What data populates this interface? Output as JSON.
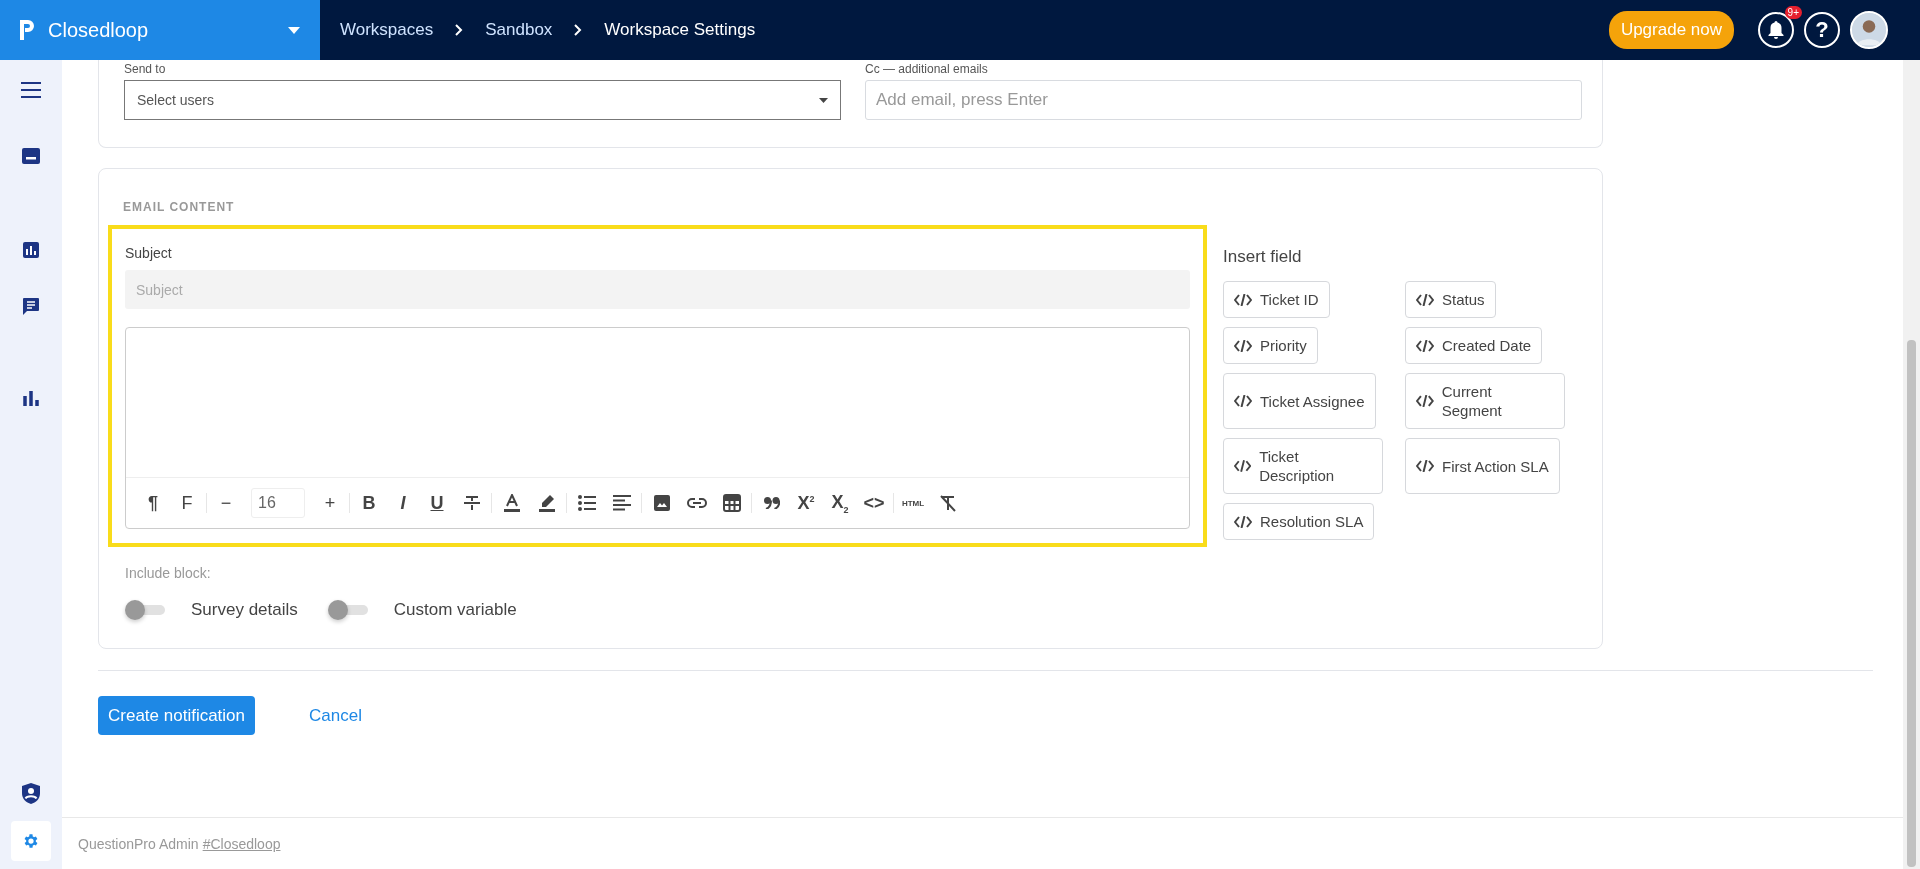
{
  "app": {
    "name": "Closedloop"
  },
  "breadcrumbs": [
    {
      "label": "Workspaces"
    },
    {
      "label": "Sandbox"
    },
    {
      "label": "Workspace Settings"
    }
  ],
  "header_actions": {
    "upgrade": "Upgrade now",
    "notification_badge": "9+",
    "help": "?"
  },
  "sidebar": {
    "items": [
      {
        "selected": false
      },
      {
        "selected": false
      },
      {
        "selected": false
      },
      {
        "selected": false
      },
      {
        "selected": false
      },
      {
        "selected": false
      },
      {
        "selected": true
      }
    ]
  },
  "recipients": {
    "send_to": {
      "label": "Send to",
      "placeholder": "Select users"
    },
    "cc": {
      "label": "Cc — additional emails",
      "placeholder": "Add email, press Enter"
    }
  },
  "email_content": {
    "heading": "EMAIL CONTENT",
    "subject": {
      "label": "Subject",
      "placeholder": "Subject"
    },
    "toolbar": [
      {
        "kind": "glyph",
        "text": "¶"
      },
      {
        "kind": "glyph",
        "text": "F"
      },
      {
        "kind": "divider"
      },
      {
        "kind": "glyph",
        "text": "−"
      },
      {
        "kind": "size",
        "text": "16"
      },
      {
        "kind": "glyph",
        "text": "+"
      },
      {
        "kind": "divider"
      },
      {
        "kind": "glyph",
        "text": "B"
      },
      {
        "kind": "glyph",
        "text": "I"
      },
      {
        "kind": "glyph",
        "text": "U"
      },
      {
        "kind": "icon"
      },
      {
        "kind": "divider"
      },
      {
        "kind": "icon"
      },
      {
        "kind": "icon"
      },
      {
        "kind": "divider"
      },
      {
        "kind": "icon"
      },
      {
        "kind": "icon"
      },
      {
        "kind": "divider"
      },
      {
        "kind": "icon"
      },
      {
        "kind": "icon"
      },
      {
        "kind": "icon"
      },
      {
        "kind": "divider"
      },
      {
        "kind": "icon"
      },
      {
        "kind": "glyph",
        "text": "X$^{2}$"
      },
      {
        "kind": "glyph",
        "text": "X$_{2}$"
      },
      {
        "kind": "glyph",
        "text": "<>"
      },
      {
        "kind": "divider"
      },
      {
        "kind": "glyph",
        "text": "HTML"
      },
      {
        "kind": "icon"
      }
    ],
    "insert_field": {
      "title": "Insert field",
      "fields": [
        {
          "label": "Ticket ID"
        },
        {
          "label": "Status"
        },
        {
          "label": "Priority"
        },
        {
          "label": "Created Date"
        },
        {
          "label": "Ticket Assignee"
        },
        {
          "label": "Current Segment"
        },
        {
          "label": "Ticket Description"
        },
        {
          "label": "First Action SLA"
        },
        {
          "label": "Resolution SLA"
        }
      ]
    },
    "include_block": {
      "label": "Include block:",
      "toggles": [
        {
          "label": "Survey details",
          "on": false
        },
        {
          "label": "Custom variable",
          "on": false
        }
      ]
    }
  },
  "actions": {
    "primary": "Create notification",
    "cancel": "Cancel"
  },
  "footer": {
    "text": "QuestionPro Admin",
    "link": "#Closedloop"
  }
}
